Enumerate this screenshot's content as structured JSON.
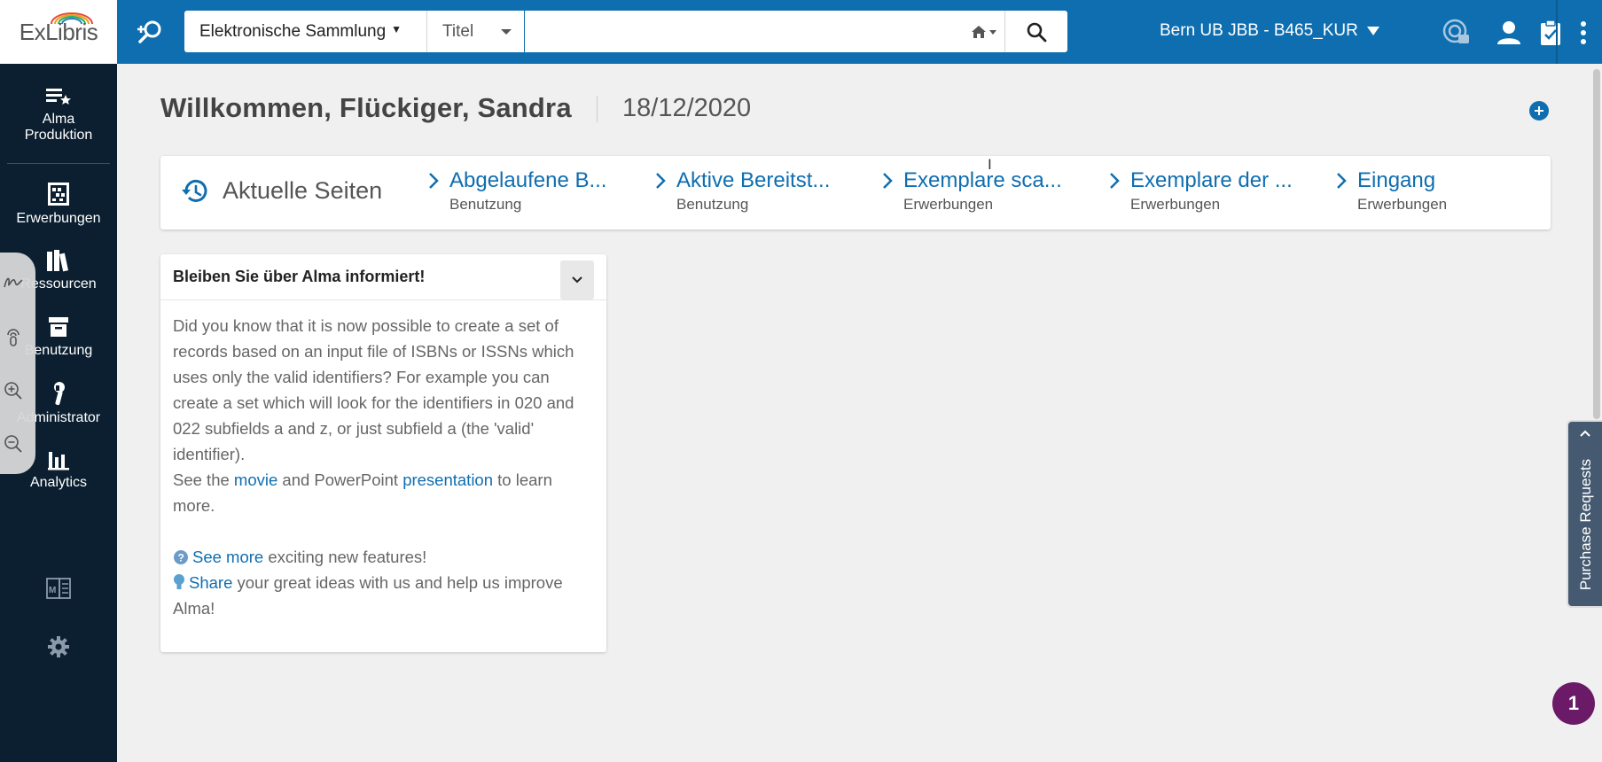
{
  "logo": {
    "text": "ExLibris"
  },
  "search": {
    "scope_label": "Elektronische Sammlung",
    "field_label": "Titel",
    "query_value": "",
    "placeholder": ""
  },
  "header": {
    "institution": "Bern UB JBB - B465_KUR",
    "icons": [
      "advanced-search-icon",
      "home-icon",
      "search-icon",
      "widgets-icon",
      "user-icon",
      "task-list-icon",
      "more-vert-icon"
    ],
    "brand_color": "#0f6eb0"
  },
  "nav": {
    "items": [
      {
        "label_line1": "Alma",
        "label_line2": "Produktion",
        "icon": "list-star-icon"
      },
      {
        "label": "Erwerbungen",
        "icon": "abacus-icon"
      },
      {
        "label": "Ressourcen",
        "icon": "books-icon"
      },
      {
        "label": "Benutzung",
        "icon": "archive-box-icon"
      },
      {
        "label": "Administrator",
        "icon": "wrench-icon"
      },
      {
        "label": "Analytics",
        "icon": "bar-chart-icon"
      }
    ],
    "bottom_icons": [
      "manual-icon",
      "settings-icon"
    ]
  },
  "float_tools": [
    "draw-icon",
    "touch-icon",
    "zoom-in-icon",
    "zoom-out-icon"
  ],
  "welcome": {
    "greeting": "Willkommen, Flückiger, Sandra",
    "date": "18/12/2020"
  },
  "recent": {
    "title": "Aktuelle Seiten",
    "links": [
      {
        "title": "Abgelaufene B...",
        "subtitle": "Benutzung"
      },
      {
        "title": "Aktive Bereitst...",
        "subtitle": "Benutzung"
      },
      {
        "title": "Exemplare sca...",
        "subtitle": "Erwerbungen"
      },
      {
        "title": "Exemplare der ...",
        "subtitle": "Erwerbungen"
      },
      {
        "title": "Eingang",
        "subtitle": "Erwerbungen"
      }
    ]
  },
  "widget": {
    "title": "Bleiben Sie über Alma informiert!",
    "para1": "Did you know that it is now possible to create a set of records based on an input file of ISBNs or ISSNs which uses only the valid identifiers? For example you can create a set which will look for the identifiers in 020 and 022 subfields a and z, or just subfield a (the 'valid' identifier).",
    "see_the": "See the ",
    "movie_link": "movie",
    "and_pp": " and PowerPoint ",
    "presentation_link": "presentation",
    "to_learn": " to learn more.",
    "see_more_link": "See more",
    "see_more_rest": " exciting new features!",
    "share_link": "Share",
    "share_rest": " your great ideas with us and help us improve Alma!"
  },
  "purchase_tab": {
    "label": "Purchase Requests"
  },
  "notification": {
    "count": "1"
  }
}
